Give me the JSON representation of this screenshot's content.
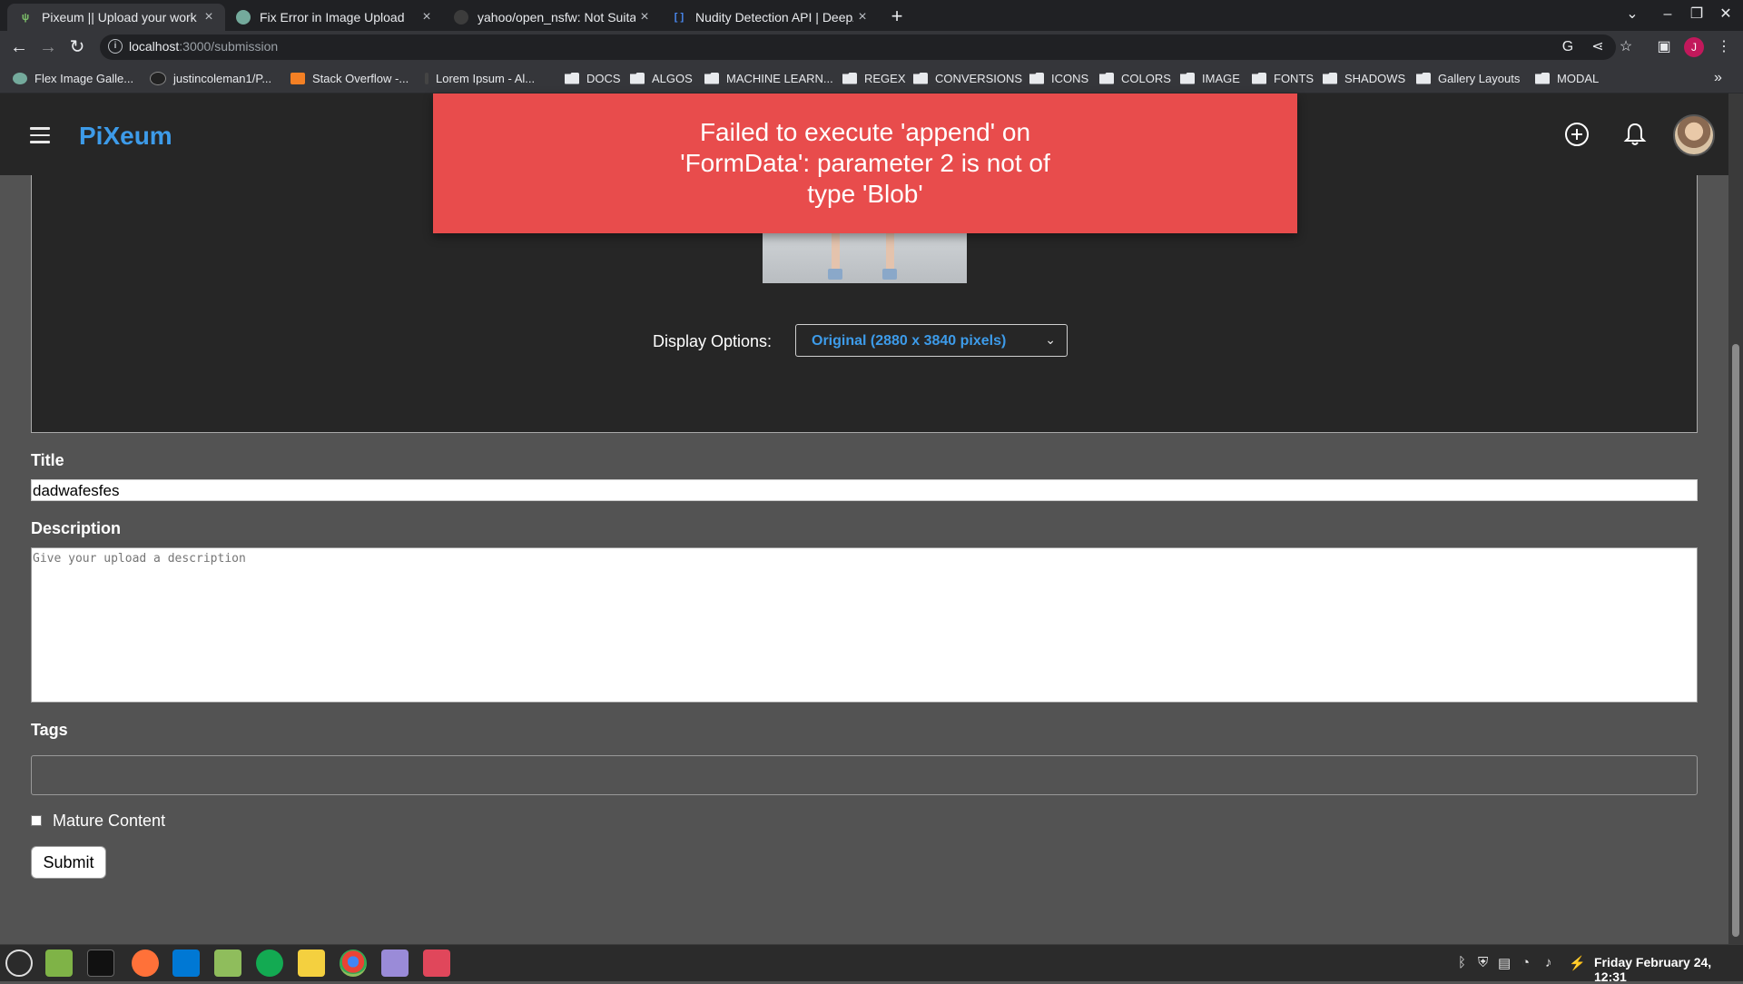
{
  "browser": {
    "tabs": [
      {
        "title": "Pixeum || Upload your work",
        "icon": "pixeum-favicon",
        "active": true
      },
      {
        "title": "Fix Error in Image Upload",
        "icon": "openai-favicon",
        "active": false
      },
      {
        "title": "yahoo/open_nsfw: Not Suitab",
        "icon": "github-favicon",
        "active": false
      },
      {
        "title": "Nudity Detection API | DeepAI",
        "icon": "deepai-favicon",
        "active": false
      }
    ],
    "url_host": "localhost",
    "url_path": ":3000/submission",
    "profile_initial": "J",
    "bookmarks": [
      {
        "label": "Flex Image Galle...",
        "type": "link"
      },
      {
        "label": "justincoleman1/P...",
        "type": "link"
      },
      {
        "label": "Stack Overflow -...",
        "type": "link"
      },
      {
        "label": "Lorem Ipsum - Al...",
        "type": "link"
      },
      {
        "label": "DOCS",
        "type": "folder"
      },
      {
        "label": "ALGOS",
        "type": "folder"
      },
      {
        "label": "MACHINE LEARN...",
        "type": "folder"
      },
      {
        "label": "REGEX",
        "type": "folder"
      },
      {
        "label": "CONVERSIONS",
        "type": "folder"
      },
      {
        "label": "ICONS",
        "type": "folder"
      },
      {
        "label": "COLORS",
        "type": "folder"
      },
      {
        "label": "IMAGE",
        "type": "folder"
      },
      {
        "label": "FONTS",
        "type": "folder"
      },
      {
        "label": "SHADOWS",
        "type": "folder"
      },
      {
        "label": "Gallery Layouts",
        "type": "folder"
      },
      {
        "label": "MODAL",
        "type": "folder"
      }
    ]
  },
  "app": {
    "logo": "PiXeum",
    "accent_color": "#3d9be9",
    "error_color": "#e84c4c"
  },
  "toast": {
    "message": "Failed to execute 'append' on 'FormData': parameter 2 is not of type 'Blob'"
  },
  "preview": {
    "display_label": "Display Options:",
    "display_value": "Original (2880 x 3840 pixels)"
  },
  "form": {
    "title_label": "Title",
    "title_value": "dadwafesfes",
    "description_label": "Description",
    "description_placeholder": "Give your upload a description",
    "tags_label": "Tags",
    "tags_value": "",
    "mature_label": "Mature Content",
    "mature_checked": false,
    "submit_label": "Submit"
  },
  "taskbar": {
    "clock": "Friday February 24, 12:31"
  }
}
